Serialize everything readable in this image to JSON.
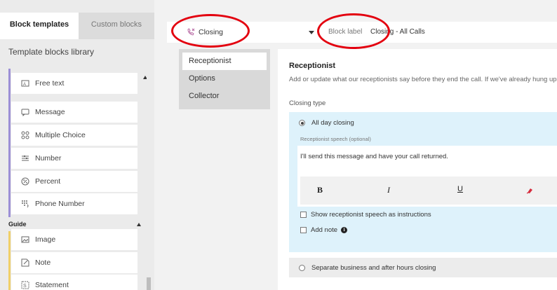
{
  "sidebar": {
    "tabs": [
      {
        "label": "Block templates",
        "active": true
      },
      {
        "label": "Custom blocks",
        "active": false
      }
    ],
    "library_title": "Template blocks library",
    "items": [
      {
        "label": "Free text",
        "icon": "free-text-icon"
      },
      {
        "label": "Message",
        "icon": "message-icon"
      },
      {
        "label": "Multiple Choice",
        "icon": "multiple-choice-icon"
      },
      {
        "label": "Number",
        "icon": "number-icon"
      },
      {
        "label": "Percent",
        "icon": "percent-icon"
      },
      {
        "label": "Phone Number",
        "icon": "phone-number-icon"
      }
    ],
    "guide_label": "Guide",
    "guide_items": [
      {
        "label": "Image",
        "icon": "image-icon"
      },
      {
        "label": "Note",
        "icon": "note-icon"
      },
      {
        "label": "Statement",
        "icon": "statement-icon"
      }
    ]
  },
  "topbar": {
    "closing_label": "Closing",
    "block_label_caption": "Block label",
    "block_label_value": "Closing - All Calls"
  },
  "secnav": {
    "items": [
      "Receptionist",
      "Options",
      "Collector"
    ]
  },
  "card": {
    "title": "Receptionist",
    "description": "Add or update what our receptionists say before they end the call. If we've already hung up (",
    "closing_type": "Closing type",
    "option_all_day": "All day closing",
    "speech_label": "Receptionist speech (optional)",
    "speech_text": "I'll send this message and have your call returned.",
    "formatting": {
      "bold": "B",
      "italic": "I",
      "underline": "U"
    },
    "show_instructions": "Show receptionist speech as instructions",
    "add_note": "Add note",
    "option_separate": "Separate business and after hours closing"
  },
  "colors": {
    "annotation": "#e3000f",
    "panel_blue": "#def2fb",
    "guide_accent": "#f0d068",
    "fields_accent": "#9c8fd6"
  }
}
